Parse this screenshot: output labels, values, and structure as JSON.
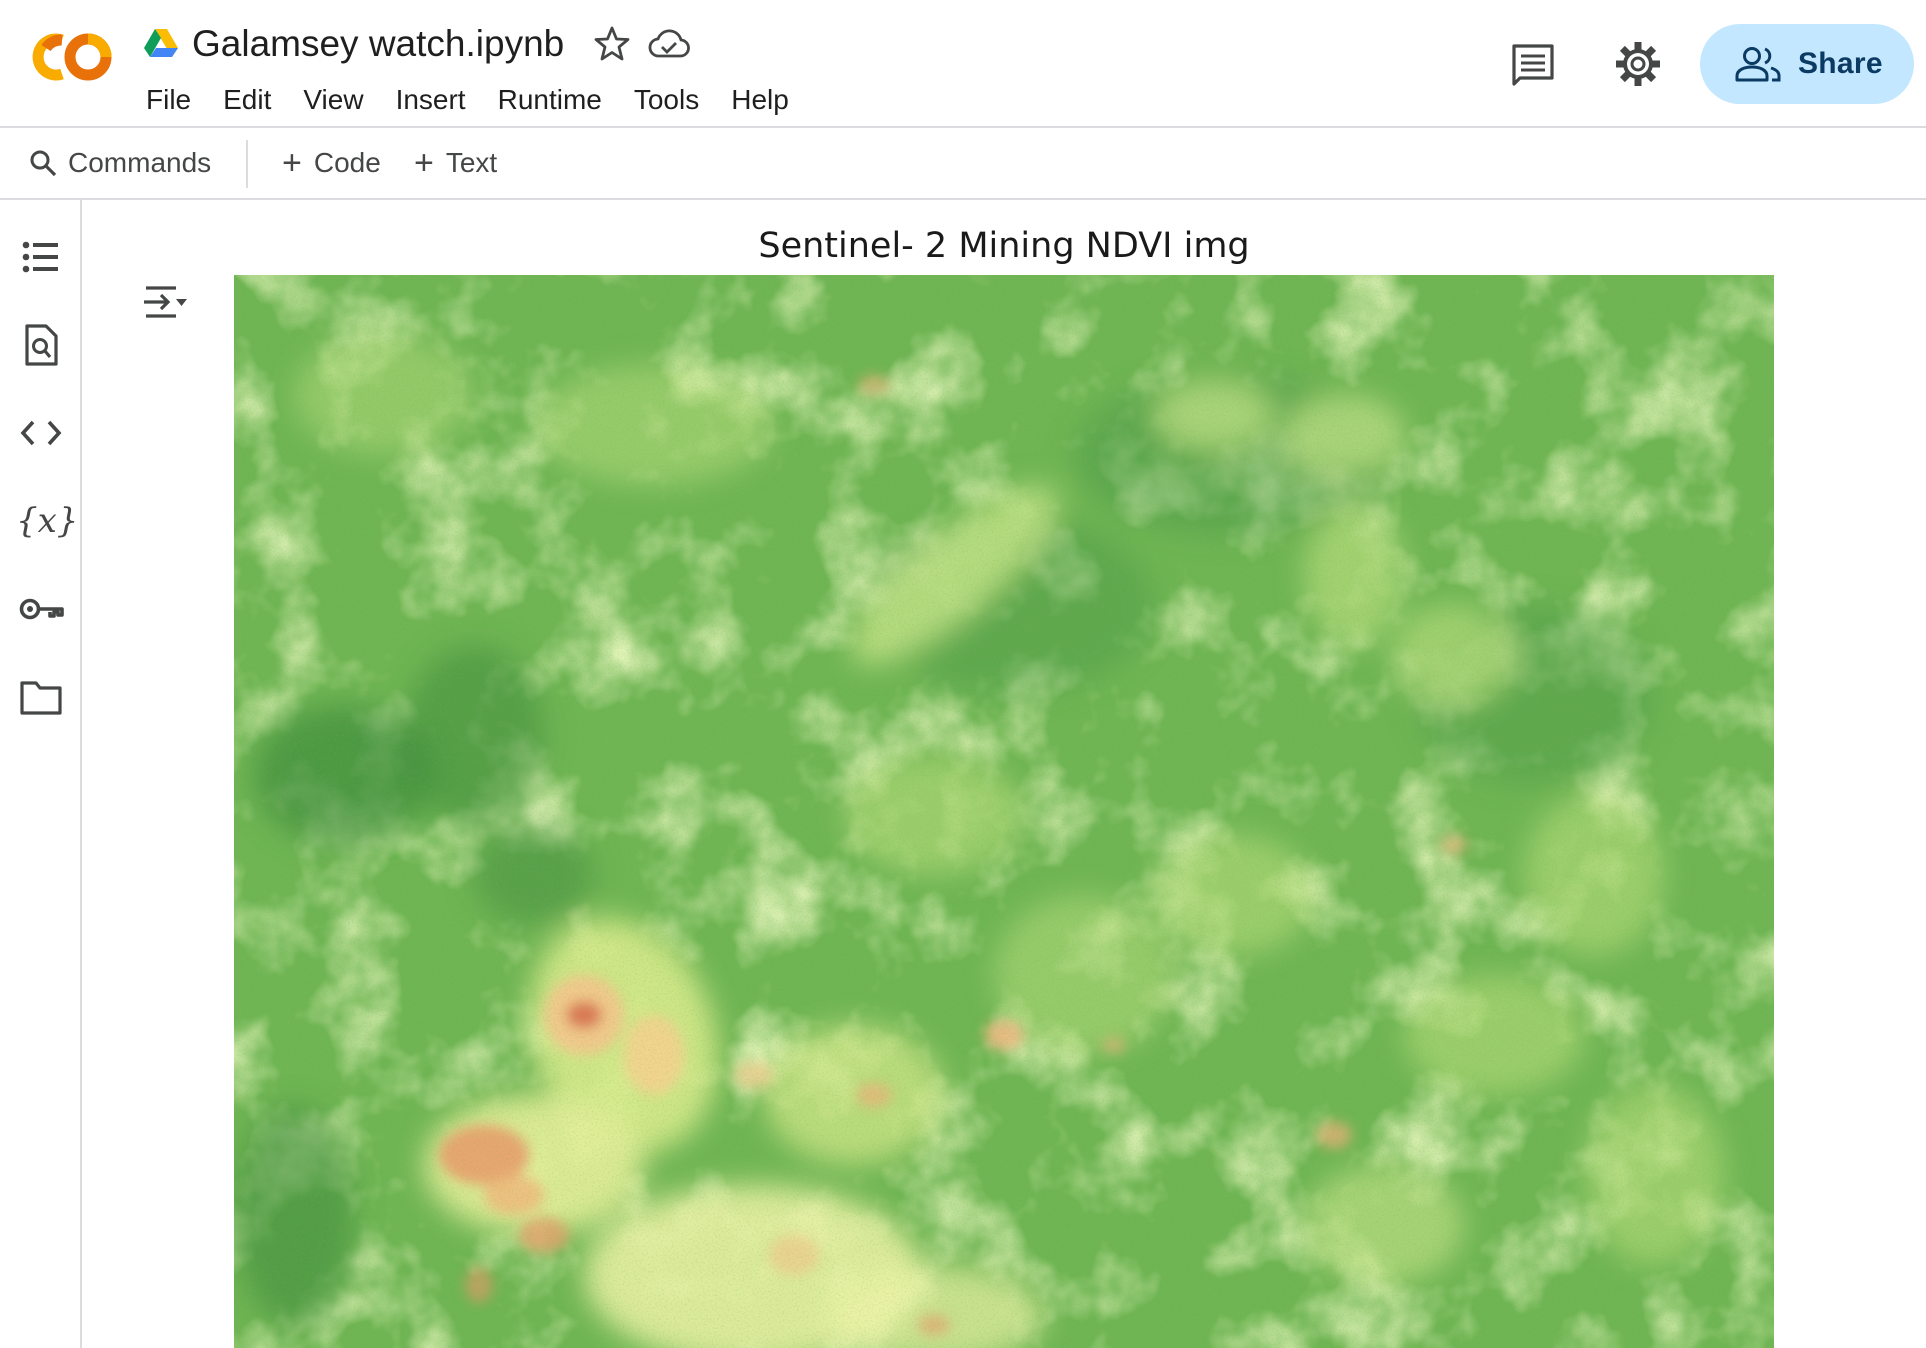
{
  "header": {
    "doc_title": "Galamsey watch.ipynb",
    "menu": [
      "File",
      "Edit",
      "View",
      "Insert",
      "Runtime",
      "Tools",
      "Help"
    ],
    "share_label": "Share"
  },
  "toolbar": {
    "commands_label": "Commands",
    "code_label": "Code",
    "text_label": "Text"
  },
  "sidebar": {
    "items": [
      "table-of-contents",
      "find-replace",
      "code-snippets",
      "variables",
      "secrets",
      "files"
    ],
    "variables_glyph": "{x}"
  },
  "output": {
    "plot_title": "Sentinel- 2 Mining NDVI img"
  },
  "colors": {
    "share_bg": "#c2e7ff",
    "ndvi_high": "#4e9b48",
    "ndvi_mid": "#9fd16a",
    "ndvi_low": "#fbf6b8",
    "ndvi_bare": "#e38a5e"
  }
}
